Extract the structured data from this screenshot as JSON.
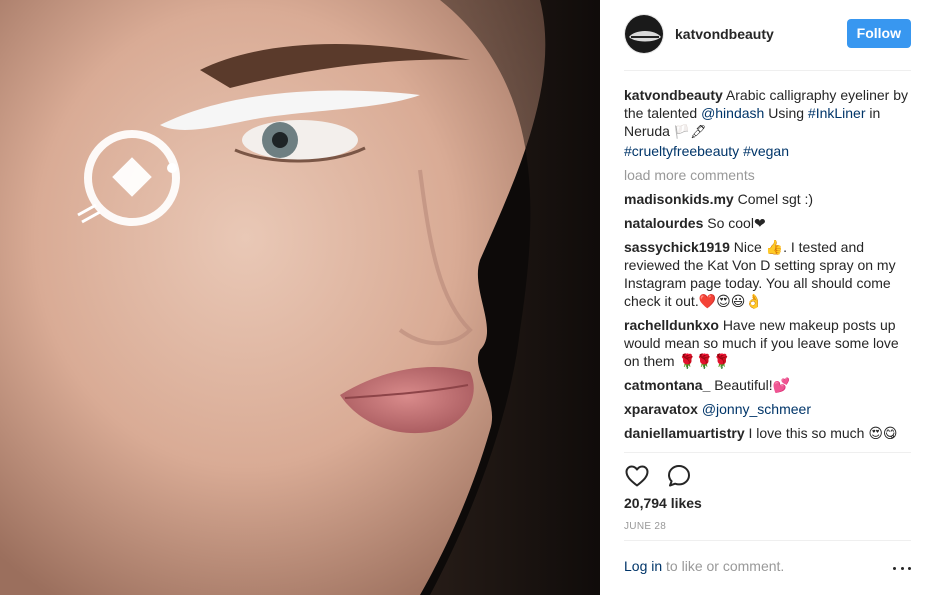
{
  "post": {
    "username": "katvondbeauty",
    "follow_label": "Follow",
    "image_alt_icon": "portrait-photo"
  },
  "caption": {
    "username": "katvondbeauty",
    "text_1": " Arabic calligraphy eyeliner by the talented ",
    "mention": "@hindash",
    "text_2": "  Using ",
    "hashtag_1": "#InkLiner",
    "text_3": " in Neruda ",
    "emoji": "🏳️🖋",
    "hashtag_2": "#crueltyfreebeauty",
    "hashtag_3": "#vegan"
  },
  "load_more": "load more comments",
  "comments": [
    {
      "user": "madisonkids.my",
      "text": "Comel sgt :)"
    },
    {
      "user": "natalourdes",
      "text": "So cool❤"
    },
    {
      "user": "sassychick1919",
      "text": "Nice 👍. I tested and reviewed the Kat Von D setting spray on my Instagram page today. You all should come check it out.❤️😍😃👌"
    },
    {
      "user": "rachelldunkxo",
      "text": "Have new makeup posts up would mean so much if you leave some love on them 🌹🌹🌹"
    },
    {
      "user": "catmontana_",
      "text": "Beautiful!💕"
    },
    {
      "user": "xparavatox",
      "mention": "@jonny_schmeer"
    },
    {
      "user": "daniellamuartistry",
      "text": "I love this so much 😍😋"
    }
  ],
  "actions": {
    "like_icon": "heart-icon",
    "comment_icon": "comment-icon"
  },
  "likes": "20,794 likes",
  "date": "JUNE 28",
  "footer": {
    "login": "Log in",
    "rest": " to like or comment."
  },
  "colors": {
    "accent": "#3897f0",
    "link": "#003569",
    "muted": "#999999"
  }
}
